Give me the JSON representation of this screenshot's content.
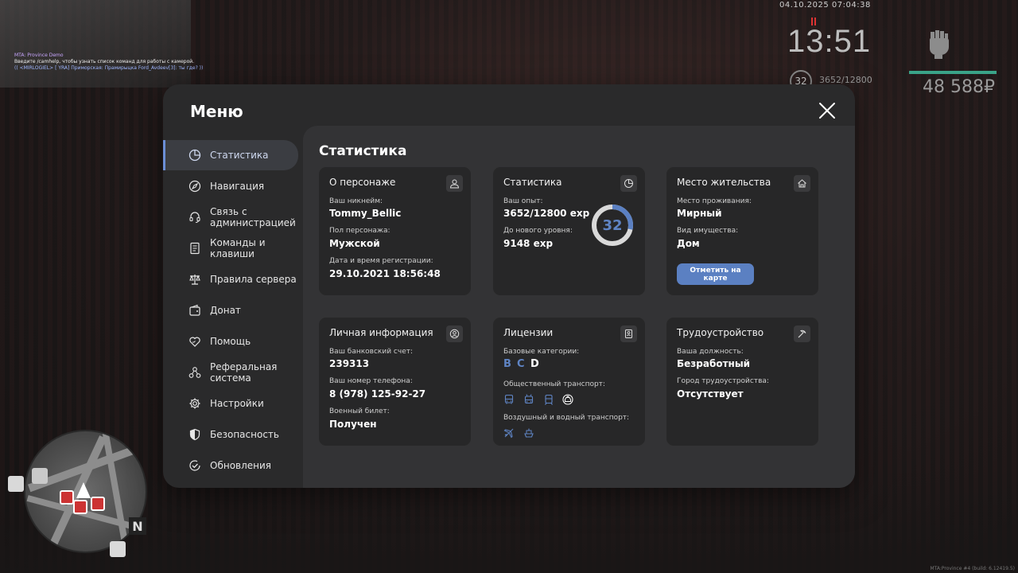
{
  "hud": {
    "chat": [
      "MTA: Province Demo",
      "Введите /camhelp, чтобы узнать список команд для работы с камерой.",
      "(( <MIRLOGIEL> [ YRA] Приморская: Прамирыцка Ford_Avdeev[3]: ты где? ))"
    ],
    "date": "04.10.2025 07:04:38",
    "time": "13:51",
    "level": "32",
    "exp": "3652/12800",
    "money": "48 588₽",
    "build": "MTA:Province #4 (build: 6.12419.5)",
    "compass": "N"
  },
  "menu": {
    "title": "Меню",
    "nav": [
      {
        "label": "Статистика",
        "icon": "pie-chart-icon",
        "active": true
      },
      {
        "label": "Навигация",
        "icon": "compass-icon"
      },
      {
        "label": "Связь с администрацией",
        "icon": "headset-icon"
      },
      {
        "label": "Команды и клавиши",
        "icon": "document-icon"
      },
      {
        "label": "Правила сервера",
        "icon": "scales-icon"
      },
      {
        "label": "Донат",
        "icon": "wallet-icon"
      },
      {
        "label": "Помощь",
        "icon": "heart-hand-icon"
      },
      {
        "label": "Реферальная система",
        "icon": "network-icon"
      },
      {
        "label": "Настройки",
        "icon": "gear-icon"
      },
      {
        "label": "Безопасность",
        "icon": "shield-icon"
      },
      {
        "label": "Обновления",
        "icon": "check-circle-icon"
      }
    ]
  },
  "content": {
    "title": "Статистика",
    "character": {
      "title": "О персонаже",
      "nickname_label": "Ваш никнейм:",
      "nickname": "Tommy_Bellic",
      "gender_label": "Пол персонажа:",
      "gender": "Мужской",
      "reg_label": "Дата и время регистрации:",
      "reg": "29.10.2021 18:56:48"
    },
    "stats": {
      "title": "Статистика",
      "exp_label": "Ваш опыт:",
      "exp": "3652/12800 exp",
      "next_label": "До нового уровня:",
      "next": "9148 exp",
      "level": "32",
      "progress": 0.285
    },
    "residence": {
      "title": "Место жительства",
      "place_label": "Место проживания:",
      "place": "Мирный",
      "type_label": "Вид имущества:",
      "type": "Дом",
      "button": "Отметить на карте"
    },
    "personal": {
      "title": "Личная информация",
      "bank_label": "Ваш банковский счет:",
      "bank": "239313",
      "phone_label": "Ваш номер телефона:",
      "phone": "8 (978) 125-92-27",
      "military_label": "Военный билет:",
      "military": "Получен"
    },
    "licenses": {
      "title": "Лицензии",
      "base_label": "Базовые категории:",
      "categories": [
        "B",
        "C",
        "D"
      ],
      "public_label": "Общественный транспорт:",
      "air_label": "Воздушный и водный транспорт:"
    },
    "employment": {
      "title": "Трудоустройство",
      "position_label": "Ваша должность:",
      "position": "Безработный",
      "city_label": "Город трудоустройства:",
      "city": "Отсутствует"
    }
  },
  "colors": {
    "accent": "#5b80c2",
    "inactive_category": "#5f84c4",
    "active_category": "#ffffff",
    "hud_bar": "#3aa388"
  }
}
